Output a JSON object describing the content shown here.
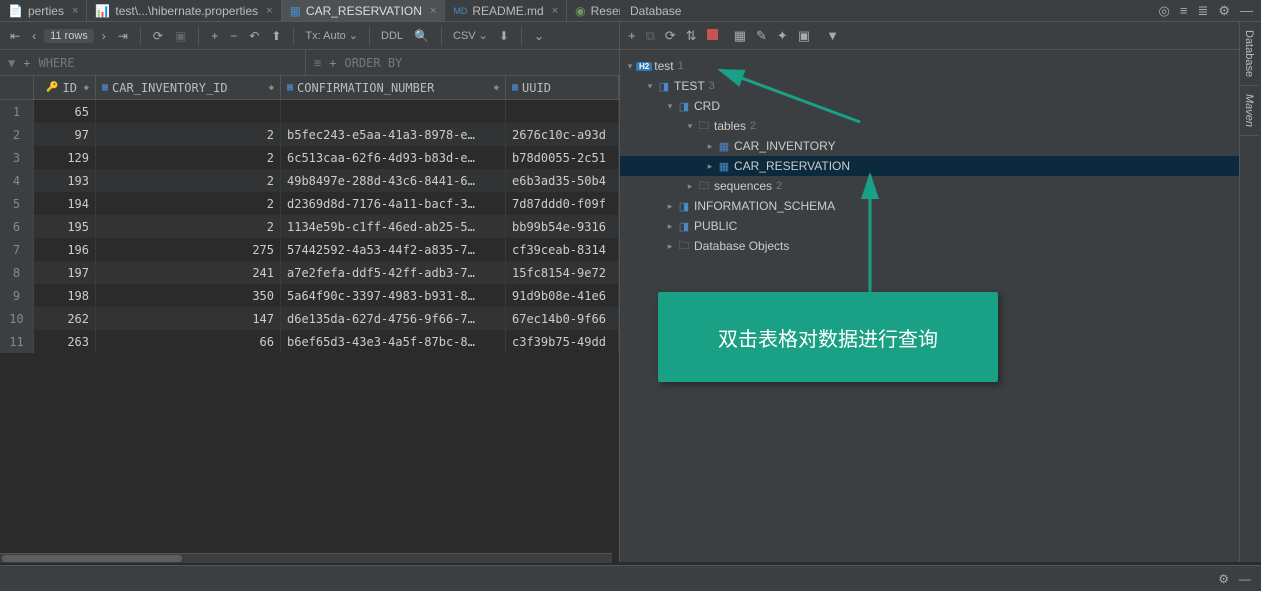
{
  "tabs": [
    {
      "label": "perties",
      "icon": "file"
    },
    {
      "label": "test\\...\\hibernate.properties",
      "icon": "stats"
    },
    {
      "label": "CAR_RESERVATION",
      "icon": "table",
      "active": true
    },
    {
      "label": "README.md",
      "icon": "md"
    },
    {
      "label": "Reserv",
      "icon": "circle"
    }
  ],
  "db_panel_title": "Database",
  "rows_label": "11 rows",
  "tx_label": "Tx: Auto",
  "ddl_label": "DDL",
  "csv_label": "CSV",
  "where_label": "WHERE",
  "order_label": "ORDER BY",
  "columns": {
    "id": "ID",
    "inv": "CAR_INVENTORY_ID",
    "conf": "CONFIRMATION_NUMBER",
    "uuid": "UUID"
  },
  "rows": [
    {
      "n": "1",
      "id": "65",
      "inv": "<null>",
      "conf": "<null>",
      "uuid": "<null>",
      "null": true
    },
    {
      "n": "2",
      "id": "97",
      "inv": "2",
      "conf": "b5fec243-e5aa-41a3-8978-e…",
      "uuid": "2676c10c-a93d"
    },
    {
      "n": "3",
      "id": "129",
      "inv": "2",
      "conf": "6c513caa-62f6-4d93-b83d-e…",
      "uuid": "b78d0055-2c51"
    },
    {
      "n": "4",
      "id": "193",
      "inv": "2",
      "conf": "49b8497e-288d-43c6-8441-6…",
      "uuid": "e6b3ad35-50b4"
    },
    {
      "n": "5",
      "id": "194",
      "inv": "2",
      "conf": "d2369d8d-7176-4a11-bacf-3…",
      "uuid": "7d87ddd0-f09f"
    },
    {
      "n": "6",
      "id": "195",
      "inv": "2",
      "conf": "1134e59b-c1ff-46ed-ab25-5…",
      "uuid": "bb99b54e-9316"
    },
    {
      "n": "7",
      "id": "196",
      "inv": "275",
      "conf": "57442592-4a53-44f2-a835-7…",
      "uuid": "cf39ceab-8314"
    },
    {
      "n": "8",
      "id": "197",
      "inv": "241",
      "conf": "a7e2fefa-ddf5-42ff-adb3-7…",
      "uuid": "15fc8154-9e72"
    },
    {
      "n": "9",
      "id": "198",
      "inv": "350",
      "conf": "5a64f90c-3397-4983-b931-8…",
      "uuid": "91d9b08e-41e6"
    },
    {
      "n": "10",
      "id": "262",
      "inv": "147",
      "conf": "d6e135da-627d-4756-9f66-7…",
      "uuid": "67ec14b0-9f66"
    },
    {
      "n": "11",
      "id": "263",
      "inv": "66",
      "conf": "b6ef65d3-43e3-4a5f-87bc-8…",
      "uuid": "c3f39b75-49dd"
    }
  ],
  "tree": {
    "root": "test",
    "root_count": "1",
    "schema": "TEST",
    "schema_count": "3",
    "crd": "CRD",
    "tables_label": "tables",
    "tables_count": "2",
    "table1": "CAR_INVENTORY",
    "table2": "CAR_RESERVATION",
    "seq_label": "sequences",
    "seq_count": "2",
    "info_schema": "INFORMATION_SCHEMA",
    "public": "PUBLIC",
    "db_objects": "Database Objects"
  },
  "callout_text": "双击表格对数据进行查询",
  "side_tabs": {
    "database": "Database",
    "maven": "Maven"
  }
}
